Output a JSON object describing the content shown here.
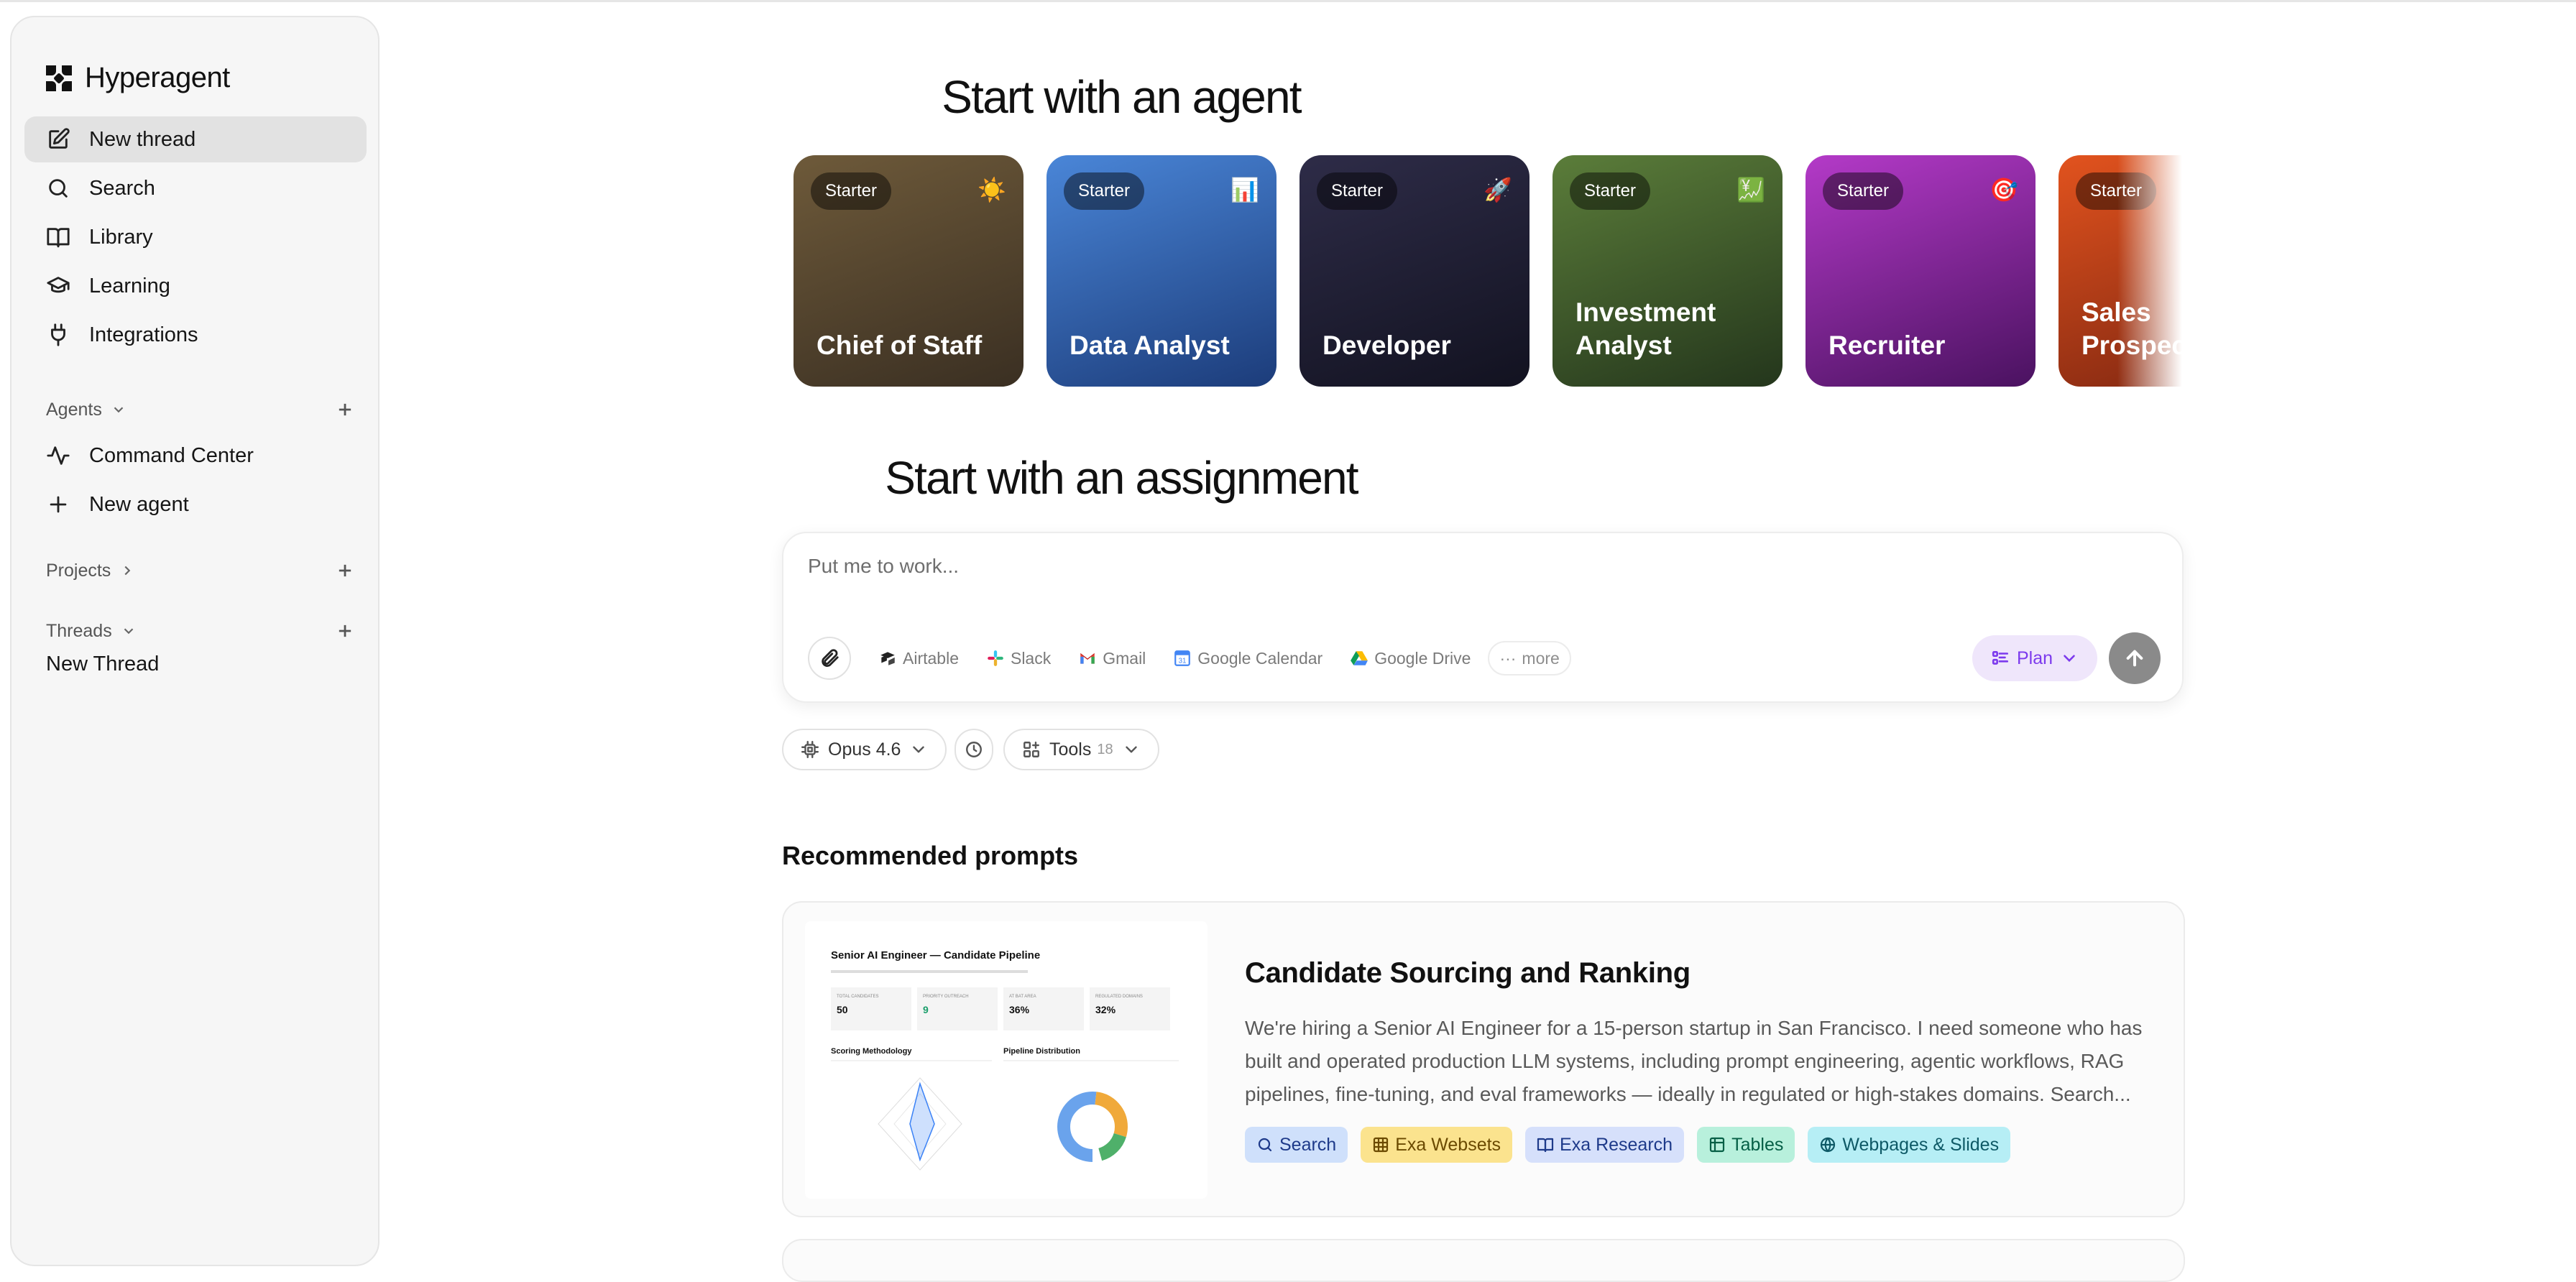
{
  "app": {
    "name": "Hyperagent"
  },
  "sidebar": {
    "nav": [
      {
        "label": "New thread",
        "icon": "edit-icon",
        "active": true
      },
      {
        "label": "Search",
        "icon": "search-icon"
      },
      {
        "label": "Library",
        "icon": "book-icon"
      },
      {
        "label": "Learning",
        "icon": "graduation-cap-icon"
      },
      {
        "label": "Integrations",
        "icon": "plug-icon"
      }
    ],
    "agents_label": "Agents",
    "agents_items": [
      {
        "label": "Command Center",
        "icon": "activity-icon"
      },
      {
        "label": "New agent",
        "icon": "plus-icon"
      }
    ],
    "projects_label": "Projects",
    "threads_label": "Threads",
    "threads": [
      {
        "label": "New Thread"
      }
    ]
  },
  "main": {
    "agents_heading": "Start with an agent",
    "agent_cards": [
      {
        "badge": "Starter",
        "title": "Chief of Staff",
        "emoji": "☀️",
        "gradient": [
          "#6e5a3a",
          "#3a2f22"
        ]
      },
      {
        "badge": "Starter",
        "title": "Data Analyst",
        "emoji": "📊",
        "gradient": [
          "#4a86d8",
          "#1c3c7a"
        ]
      },
      {
        "badge": "Starter",
        "title": "Developer",
        "emoji": "🚀",
        "gradient": [
          "#2e2c48",
          "#121220"
        ]
      },
      {
        "badge": "Starter",
        "title": "Investment Analyst",
        "emoji": "💹",
        "gradient": [
          "#5b7d3a",
          "#24361c"
        ]
      },
      {
        "badge": "Starter",
        "title": "Recruiter",
        "emoji": "🎯",
        "gradient": [
          "#b43ac8",
          "#4a1260"
        ]
      },
      {
        "badge": "Starter",
        "title": "Sales Prospector",
        "emoji": "",
        "gradient": [
          "#e2531e",
          "#7a2410"
        ]
      }
    ],
    "assignment_heading": "Start with an assignment",
    "composer": {
      "placeholder": "Put me to work...",
      "integrations": [
        {
          "label": "Airtable",
          "icon": "airtable-icon"
        },
        {
          "label": "Slack",
          "icon": "slack-icon"
        },
        {
          "label": "Gmail",
          "icon": "gmail-icon"
        },
        {
          "label": "Google Calendar",
          "icon": "google-calendar-icon"
        },
        {
          "label": "Google Drive",
          "icon": "google-drive-icon"
        }
      ],
      "more_label": "more",
      "plan_label": "Plan"
    },
    "model_label": "Opus 4.6",
    "tools_label": "Tools",
    "tools_count": "18",
    "recommended_heading": "Recommended prompts",
    "recommended": [
      {
        "title": "Candidate Sourcing and Ranking",
        "description": "We're hiring a Senior AI Engineer for a 15-person startup in San Francisco. I need someone who has built and operated production LLM systems, including prompt engineering, agentic workflows, RAG pipelines, fine-tuning, and eval frameworks — ideally in regulated or high-stakes domains. Search...",
        "thumbnail": {
          "title": "Senior AI Engineer — Candidate Pipeline",
          "stats": [
            {
              "label": "TOTAL CANDIDATES",
              "value": "50"
            },
            {
              "label": "PRIORITY OUTREACH",
              "value": "9"
            },
            {
              "label": "AT BAT AREA",
              "value": "36%"
            },
            {
              "label": "REGULATED DOMAINS",
              "value": "32%"
            }
          ],
          "left_chart_title": "Scoring Methodology",
          "right_chart_title": "Pipeline Distribution"
        },
        "tags": [
          {
            "label": "Search",
            "icon": "search-icon",
            "bg": "#cfe0fb",
            "fg": "#1e3a8a"
          },
          {
            "label": "Exa Websets",
            "icon": "grid-icon",
            "bg": "#fbe38e",
            "fg": "#6b4a00"
          },
          {
            "label": "Exa Research",
            "icon": "book-icon",
            "bg": "#d6e0fb",
            "fg": "#1e3a8a"
          },
          {
            "label": "Tables",
            "icon": "table-icon",
            "bg": "#b8f0dc",
            "fg": "#065f46"
          },
          {
            "label": "Webpages & Slides",
            "icon": "globe-icon",
            "bg": "#b6eef5",
            "fg": "#0e5966"
          }
        ]
      }
    ]
  }
}
